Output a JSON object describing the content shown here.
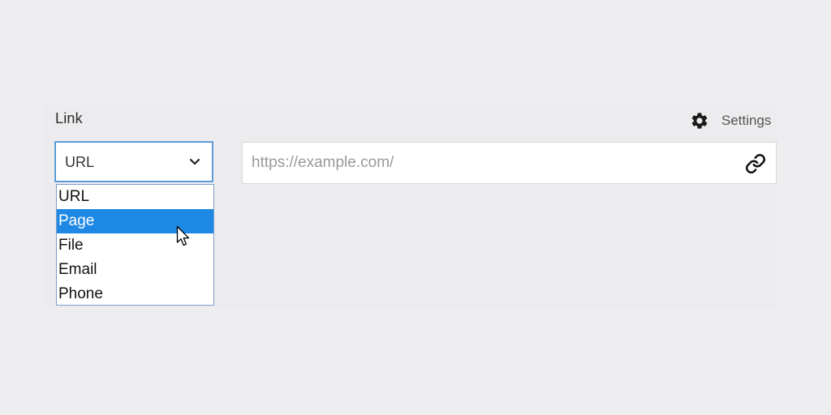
{
  "field": {
    "label": "Link"
  },
  "settings": {
    "label": "Settings",
    "icon": "gear-icon"
  },
  "link_type_select": {
    "value": "URL",
    "icon": "chevron-down-icon",
    "options": [
      {
        "label": "URL"
      },
      {
        "label": "Page"
      },
      {
        "label": "File"
      },
      {
        "label": "Email"
      },
      {
        "label": "Phone"
      }
    ],
    "highlighted_option": "Page"
  },
  "url_input": {
    "value": "",
    "placeholder": "https://example.com/",
    "icon": "link-icon"
  },
  "colors": {
    "background": "#eeeef0",
    "highlight": "#1e88e5",
    "select_border": "#4a8fce"
  }
}
